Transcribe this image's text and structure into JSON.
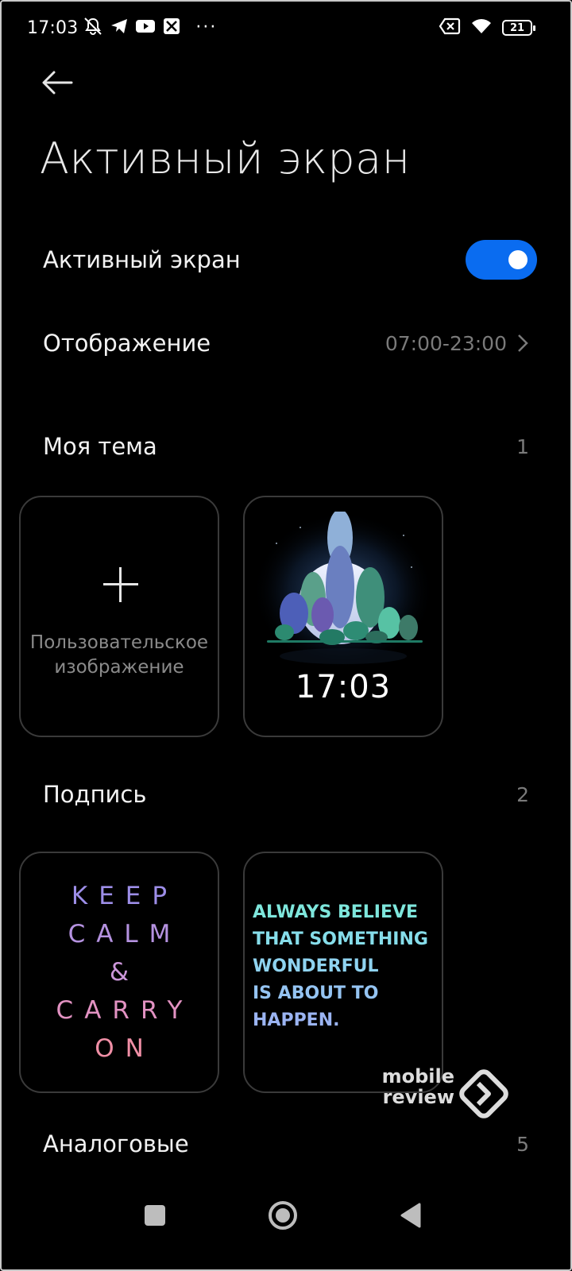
{
  "status_bar": {
    "time": "17:03",
    "left_icons": [
      "mute-icon",
      "telegram-icon",
      "youtube-icon",
      "app-icon"
    ],
    "more": "···",
    "right_icons": [
      "sim-off-icon",
      "wifi-icon",
      "battery-icon"
    ],
    "battery_level": "21"
  },
  "header": {
    "title": "Активный экран"
  },
  "settings": {
    "active_screen": {
      "label": "Активный экран",
      "enabled": true
    },
    "display": {
      "label": "Отображение",
      "value": "07:00-23:00"
    }
  },
  "sections": {
    "my_theme": {
      "title": "Моя тема",
      "count": "1",
      "add_card_label": "Пользовательское\nизображение",
      "theme_time": "17:03"
    },
    "signature": {
      "title": "Подпись",
      "count": "2",
      "card1_lines": [
        "KEEP",
        "CALM",
        "&",
        "CARRY",
        "ON"
      ],
      "card2_lines": [
        "ALWAYS BELIEVE",
        "THAT SOMETHING",
        "WONDERFUL",
        "IS ABOUT TO",
        "HAPPEN."
      ]
    },
    "analog": {
      "title": "Аналоговые",
      "count": "5"
    }
  },
  "watermark": {
    "line1": "mobile",
    "line2": "review"
  },
  "nav": {
    "icons": [
      "recents-square-icon",
      "home-circle-icon",
      "back-triangle-icon"
    ]
  },
  "colors": {
    "accent": "#0a6cf0",
    "text_secondary": "#7a7a7a",
    "card_border": "#3a3a3a",
    "keep_gradient": [
      "#9d8ee8",
      "#d79ad8",
      "#f08fa6"
    ],
    "always_gradient": [
      "#7ee6dc",
      "#8fd3f0",
      "#9bb4f2"
    ]
  }
}
